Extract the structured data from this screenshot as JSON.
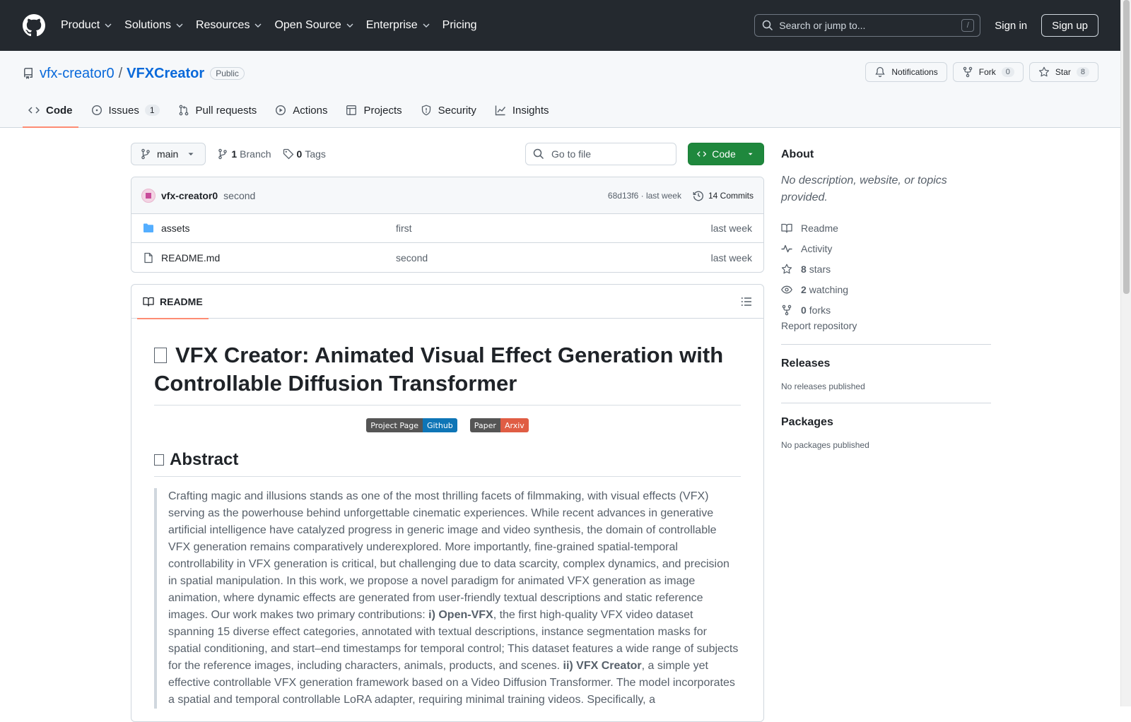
{
  "global_header": {
    "nav": [
      {
        "label": "Product",
        "has_menu": true
      },
      {
        "label": "Solutions",
        "has_menu": true
      },
      {
        "label": "Resources",
        "has_menu": true
      },
      {
        "label": "Open Source",
        "has_menu": true
      },
      {
        "label": "Enterprise",
        "has_menu": true
      },
      {
        "label": "Pricing",
        "has_menu": false
      }
    ],
    "search_placeholder": "Search or jump to...",
    "search_shortcut": "/",
    "sign_in": "Sign in",
    "sign_up": "Sign up"
  },
  "repo": {
    "owner": "vfx-creator0",
    "separator": "/",
    "name": "VFXCreator",
    "visibility": "Public",
    "notifications_label": "Notifications",
    "fork_label": "Fork",
    "fork_count": "0",
    "star_label": "Star",
    "star_count": "8",
    "tabs": {
      "code": "Code",
      "issues": "Issues",
      "issues_count": "1",
      "pulls": "Pull requests",
      "actions": "Actions",
      "projects": "Projects",
      "security": "Security",
      "insights": "Insights"
    }
  },
  "toolbar": {
    "branch": "main",
    "branch_count": "1",
    "branch_label": "Branch",
    "tag_count": "0",
    "tag_label": "Tags",
    "goto_placeholder": "Go to file",
    "code_button": "Code"
  },
  "latest_commit": {
    "author": "vfx-creator0",
    "message": "second",
    "meta": "68d13f6 · last week",
    "commits": "14 Commits"
  },
  "files": [
    {
      "name": "assets",
      "type": "dir",
      "message": "first",
      "time": "last week"
    },
    {
      "name": "README.md",
      "type": "file",
      "message": "second",
      "time": "last week"
    }
  ],
  "readme": {
    "tab_label": "README",
    "title": "VFX Creator: Animated Visual Effect Generation with Controllable Diffusion Transformer",
    "badges": [
      {
        "left": "Project Page",
        "right": "Github",
        "color": "#0e75b6"
      },
      {
        "left": "Paper",
        "right": "Arxiv",
        "color": "#e05d44"
      }
    ],
    "abstract_heading": "Abstract",
    "abstract_p1": "Crafting magic and illusions stands as one of the most thrilling facets of filmmaking, with visual effects (VFX) serving as the powerhouse behind unforgettable cinematic experiences. While recent advances in generative artificial intelligence have catalyzed progress in generic image and video synthesis, the domain of controllable VFX generation remains comparatively underexplored. More importantly, fine-grained spatial-temporal controllability in VFX generation is critical, but challenging due to data scarcity, complex dynamics, and precision in spatial manipulation. In this work, we propose a novel paradigm for animated VFX generation as image animation, where dynamic effects are generated from user-friendly textual descriptions and static reference images. Our work makes two primary contributions: ",
    "abstract_b1": "i) Open-VFX",
    "abstract_p2": ", the first high-quality VFX video dataset spanning 15 diverse effect categories, annotated with textual descriptions, instance segmentation masks for spatial conditioning, and start–end timestamps for temporal control; This dataset features a wide range of subjects for the reference images, including characters, animals, products, and scenes. ",
    "abstract_b2": "ii) VFX Creator",
    "abstract_p3": ", a simple yet effective controllable VFX generation framework based on a Video Diffusion Transformer. The model incorporates a spatial and temporal controllable LoRA adapter, requiring minimal training videos. Specifically, a"
  },
  "sidebar": {
    "about_heading": "About",
    "about_desc": "No description, website, or topics provided.",
    "readme": "Readme",
    "activity": "Activity",
    "stars_count": "8",
    "stars_label": "stars",
    "watching_count": "2",
    "watching_label": "watching",
    "forks_count": "0",
    "forks_label": "forks",
    "report": "Report repository",
    "releases_heading": "Releases",
    "releases_empty": "No releases published",
    "packages_heading": "Packages",
    "packages_empty": "No packages published"
  }
}
